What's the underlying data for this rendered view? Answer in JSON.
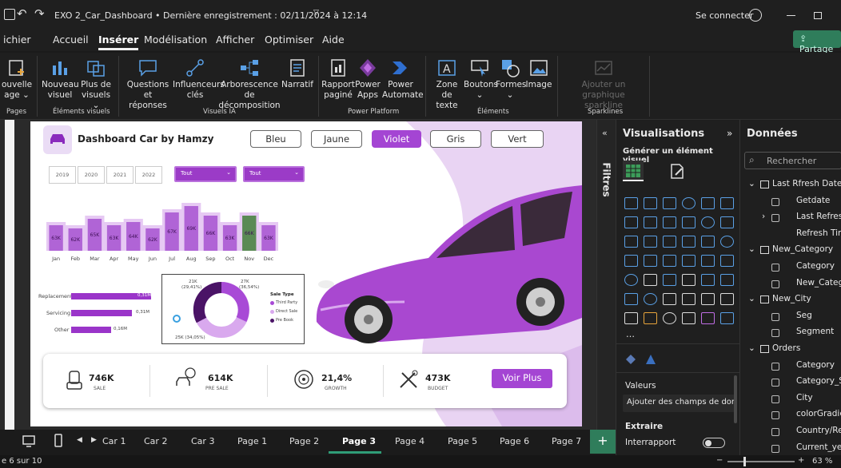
{
  "titlebar": {
    "doc_title": "EXO 2_Car_Dashboard • Dernière enregistrement : 02/11/2024 à 12:14",
    "signin": "Se connecter"
  },
  "menu": {
    "items": [
      "ichier",
      "Accueil",
      "Insérer",
      "Modélisation",
      "Afficher",
      "Optimiser",
      "Aide"
    ],
    "active": "Insérer",
    "share": "Partage"
  },
  "ribbon": {
    "pages": {
      "l1": "ouvelle",
      "l2": "age ⌄",
      "group": "Pages"
    },
    "visuals": {
      "new_l1": "Nouveau",
      "new_l2": "visuel",
      "more_l1": "Plus de",
      "more_l2": "visuels ⌄",
      "group": "Éléments visuels"
    },
    "ai": {
      "qa_l1": "Questions et",
      "qa_l2": "réponses",
      "inf_l1": "Influenceurs",
      "inf_l2": "clés",
      "tree_l1": "Arborescence de",
      "tree_l2": "décomposition",
      "narr": "Narratif",
      "group": "Visuels IA"
    },
    "platform": {
      "rp_l1": "Rapport",
      "rp_l2": "paginé",
      "pa_l1": "Power",
      "pa_l2": "Apps",
      "pau_l1": "Power",
      "pau_l2": "Automate",
      "group": "Power Platform"
    },
    "elements": {
      "tz_l1": "Zone de",
      "tz_l2": "texte",
      "btn": "Boutons",
      "btn_l2": "⌄",
      "forms": "Formes",
      "forms_l2": "⌄",
      "img": "Image",
      "group": "Éléments"
    },
    "spark": {
      "l1": "Ajouter un graphique",
      "l2": "sparkline",
      "group": "Sparklines"
    }
  },
  "report": {
    "title": "Dashboard Car by Hamzy",
    "color_buttons": [
      "Bleu",
      "Jaune",
      "Violet",
      "Gris",
      "Vert"
    ],
    "active_color": "Violet",
    "years": [
      "2019",
      "2020",
      "2021",
      "2022"
    ],
    "dropdown1": "Tout",
    "dropdown2": "Tout",
    "bar_labels": [
      "Replacement",
      "Servicing",
      "Other"
    ],
    "bar_values": [
      "0,31M",
      "0,31M",
      "0,16M"
    ],
    "donut": {
      "label_a": "21K",
      "label_a2": "(29,41%)",
      "label_b": "27K",
      "label_b2": "(36,54%)",
      "label_c": "25K (34,05%)",
      "legend_title": "Sale Type",
      "legend": [
        "Third Party",
        "Direct Sale",
        "Pre Book"
      ]
    },
    "kpis": [
      {
        "value": "746K",
        "label": "SALE"
      },
      {
        "value": "614K",
        "label": "PRE SALE"
      },
      {
        "value": "21,4%",
        "label": "GROWTH"
      },
      {
        "value": "473K",
        "label": "BUDGET"
      }
    ],
    "see_more": "Voir Plus"
  },
  "chart_data": {
    "type": "area",
    "categories": [
      "Jan",
      "Feb",
      "Mar",
      "Apr",
      "May",
      "Jun",
      "Jul",
      "Aug",
      "Sep",
      "Oct",
      "Nov",
      "Dec"
    ],
    "values": [
      63,
      62,
      65,
      63,
      64,
      62,
      67,
      69,
      66,
      63,
      66,
      63
    ],
    "labels": [
      "63K",
      "62K",
      "65K",
      "63K",
      "64K",
      "62K",
      "67K",
      "69K",
      "66K",
      "63K",
      "66K",
      "63K"
    ],
    "highlight": "Nov",
    "colors": {
      "fill": "#b064d6",
      "highlight": "#5a8a55",
      "light": "#e6c9f3"
    }
  },
  "filters": {
    "label": "Filtres"
  },
  "viz": {
    "title": "Visualisations",
    "subtitle": "Générer un élément visuel",
    "values_label": "Valeurs",
    "add_fields": "Ajouter des champs de don…",
    "extra": "Extraire",
    "cross": "Interrapport",
    "more": "…"
  },
  "data": {
    "title": "Données",
    "search": "Rechercher",
    "fields": [
      "Last Rfresh Date",
      "Getdate",
      "Last Refresh",
      "Refresh Time",
      "New_Category",
      "Category",
      "New_Categ",
      "New_City",
      "Seg",
      "Segment",
      "Orders",
      "Category",
      "Category_Sw",
      "City",
      "colorGradier",
      "Country/Reg",
      "Current_year"
    ]
  },
  "tabs": {
    "items": [
      "Car 1",
      "Car 2",
      "Car 3",
      "Page 1",
      "Page 2",
      "Page 3",
      "Page 4",
      "Page 5",
      "Page 6",
      "Page 7"
    ],
    "active": "Page 3"
  },
  "status": {
    "page": "e 6 sur 10",
    "zoom": "63 %"
  }
}
